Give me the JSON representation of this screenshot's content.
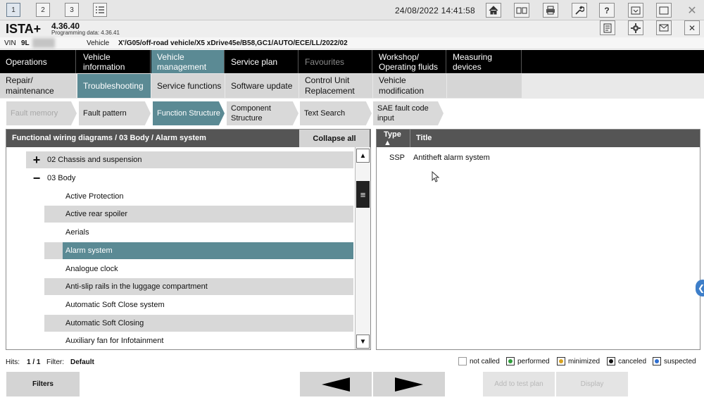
{
  "topbar": {
    "tabs": [
      "1",
      "2",
      "3"
    ],
    "datetime": "24/08/2022 14:41:58"
  },
  "header": {
    "app": "ISTA+",
    "version": "4.36.40",
    "programming_data": "Programming data:  4.36.41"
  },
  "vehicle": {
    "vin_label": "VIN",
    "vin_value": "9L",
    "vehicle_label": "Vehicle",
    "vehicle_value": "X'/G05/off-road vehicle/X5 xDrive45e/B58,GC1/AUTO/ECE/LL/2022/02"
  },
  "nav_main": [
    {
      "label": "Operations"
    },
    {
      "label": "Vehicle information"
    },
    {
      "label": "Vehicle management"
    },
    {
      "label": "Service plan"
    },
    {
      "label": "Favourites"
    },
    {
      "label": "Workshop/ Operating fluids"
    },
    {
      "label": "Measuring devices"
    }
  ],
  "nav_sub": [
    {
      "label": "Repair/ maintenance"
    },
    {
      "label": "Troubleshooting"
    },
    {
      "label": "Service functions"
    },
    {
      "label": "Software update"
    },
    {
      "label": "Control Unit Replacement"
    },
    {
      "label": "Vehicle modification"
    }
  ],
  "tabs": [
    {
      "label": "Fault memory"
    },
    {
      "label": "Fault pattern"
    },
    {
      "label": "Function Structure"
    },
    {
      "label": "Component Structure"
    },
    {
      "label": "Text Search"
    },
    {
      "label": "SAE fault code input"
    }
  ],
  "left_panel": {
    "title": "Functional wiring diagrams / 03 Body / Alarm system",
    "collapse_all": "Collapse all",
    "groups": [
      {
        "symbol": "+",
        "label": "02 Chassis and suspension"
      },
      {
        "symbol": "−",
        "label": "03 Body"
      }
    ],
    "items": [
      "Active Protection",
      "Active rear spoiler",
      "Aerials",
      "Alarm system",
      "Analogue clock",
      "Anti-slip rails in the luggage compartment",
      "Automatic Soft Close system",
      "Automatic Soft Closing",
      "Auxiliary fan for Infotainment"
    ],
    "selected": "Alarm system"
  },
  "right_panel": {
    "col_type": "Type ▲",
    "col_title": "Title",
    "rows": [
      {
        "type": "SSP",
        "title": "Antitheft alarm system"
      }
    ]
  },
  "status": {
    "hits_label": "Hits:",
    "hits_value": "1 / 1",
    "filter_label": "Filter:",
    "filter_value": "Default",
    "legend": [
      {
        "label": "not called",
        "color": "#ffffff"
      },
      {
        "label": "performed",
        "color": "#2e9e3a"
      },
      {
        "label": "minimized",
        "color": "#d9a320"
      },
      {
        "label": "canceled",
        "color": "#111111"
      },
      {
        "label": "suspected",
        "color": "#2f6fd1"
      }
    ]
  },
  "bottom": {
    "filters": "Filters",
    "add_to_test_plan": "Add to test plan",
    "display": "Display"
  }
}
